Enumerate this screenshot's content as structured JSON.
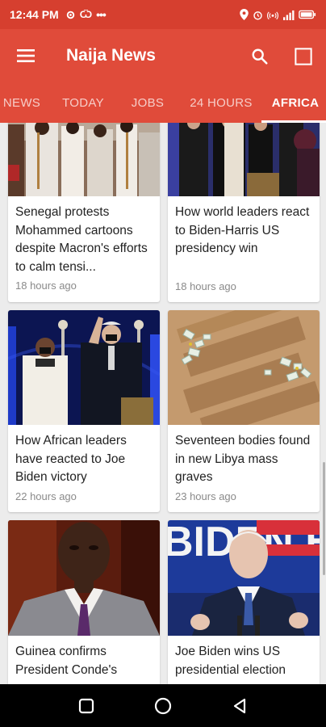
{
  "status_bar": {
    "time": "12:44 PM",
    "left_icons": [
      "settings-icon",
      "voicemail-icon",
      "more-dots-icon"
    ],
    "right_icons": [
      "location-icon",
      "alarm-icon",
      "hotspot-icon",
      "signal-icon",
      "battery-icon"
    ]
  },
  "app_bar": {
    "title": "Naija News",
    "menu_icon": "menu-icon",
    "search_icon": "search-icon",
    "square_icon": "square-icon"
  },
  "tabs": [
    {
      "label": "NEWS",
      "active": false
    },
    {
      "label": "TODAY",
      "active": false
    },
    {
      "label": "JOBS",
      "active": false
    },
    {
      "label": "24 HOURS",
      "active": false
    },
    {
      "label": "AFRICA",
      "active": true
    }
  ],
  "articles": [
    {
      "title": "Senegal protests Mohammed cartoons despite Macron's efforts to calm tensi...",
      "time": "18 hours ago"
    },
    {
      "title": "How world leaders react to Biden-Harris US presidency win",
      "time": "18 hours ago"
    },
    {
      "title": "How African leaders have reacted to Joe Biden victory",
      "time": "22 hours ago"
    },
    {
      "title": "Seventeen bodies found in new Libya mass graves",
      "time": "23 hours ago"
    },
    {
      "title": "Guinea confirms President Conde's",
      "time": ""
    },
    {
      "title": "Joe Biden wins US presidential election",
      "time": ""
    }
  ],
  "images": {
    "img3_banner_text": "BIDEN HARRIS"
  },
  "colors": {
    "status_bar": "#d63f2f",
    "app_bar": "#e04b3a",
    "background": "#ececec"
  },
  "nav_bar": [
    "recent-apps-icon",
    "home-icon",
    "back-icon"
  ]
}
